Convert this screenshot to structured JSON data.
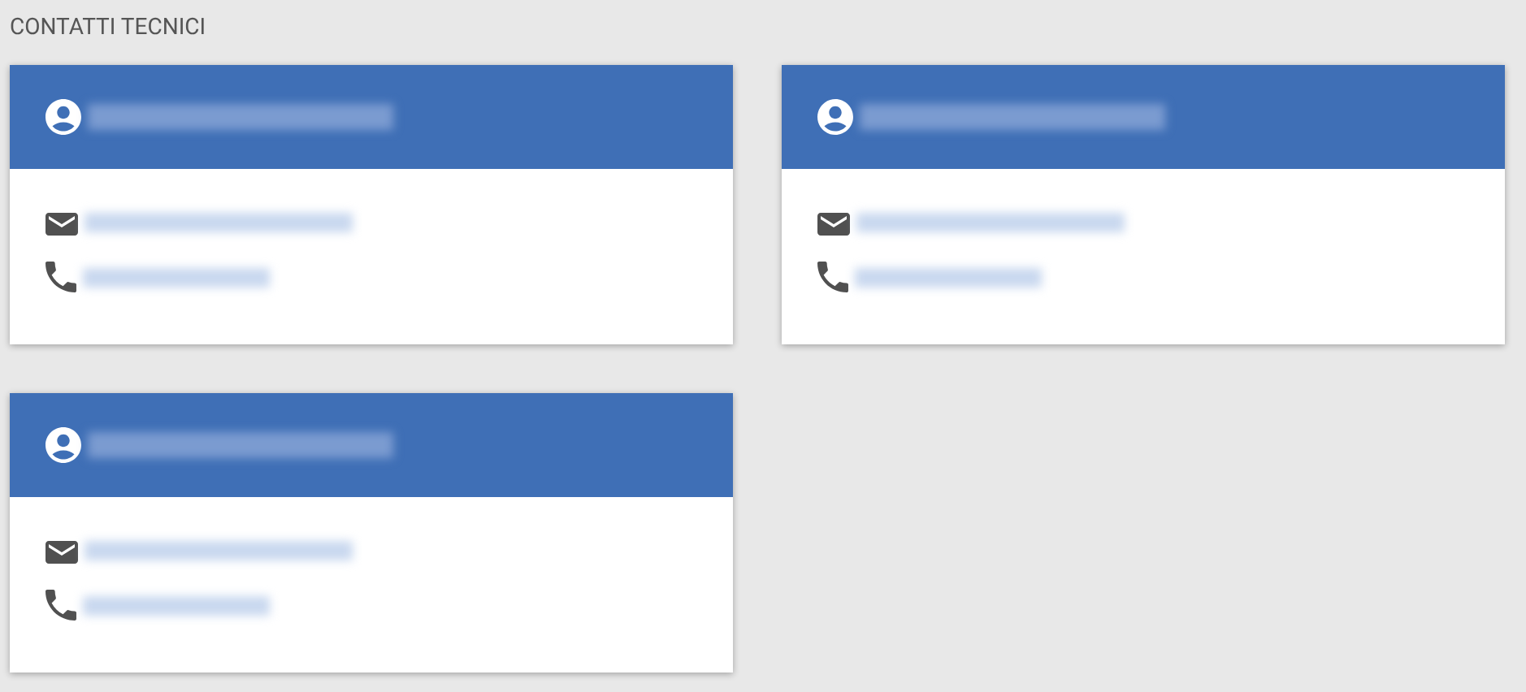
{
  "heading": "CONTATTI TECNICI",
  "contacts": [
    {
      "fields": [
        {
          "kind": "email"
        },
        {
          "kind": "phone"
        }
      ]
    },
    {
      "fields": [
        {
          "kind": "email"
        },
        {
          "kind": "phone"
        }
      ]
    },
    {
      "fields": [
        {
          "kind": "email"
        },
        {
          "kind": "phone"
        }
      ]
    }
  ]
}
